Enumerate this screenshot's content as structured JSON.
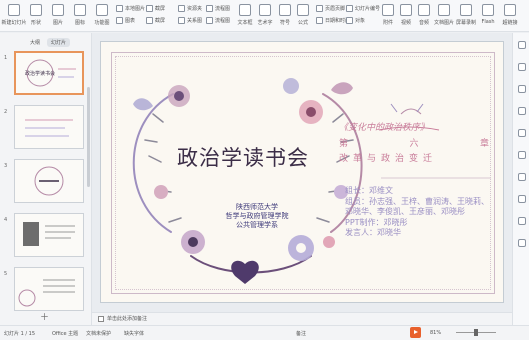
{
  "ribbon": {
    "buttons": [
      {
        "label": "新建幻灯片",
        "icon": "new-slide-icon"
      },
      {
        "label": "形状",
        "icon": "shape-icon"
      },
      {
        "label": "图片",
        "icon": "picture-icon"
      },
      {
        "label": "图标",
        "icon": "icon-icon"
      },
      {
        "label": "功能图",
        "icon": "smartart-icon"
      }
    ],
    "small": [
      [
        "本地图片",
        "图表"
      ],
      [
        "截屏",
        "截屏"
      ],
      [
        "资源夹",
        "关系图"
      ],
      [
        "流程图",
        "流程图"
      ]
    ],
    "buttons2": [
      {
        "label": "文本框",
        "icon": "textbox-icon"
      },
      {
        "label": "艺术字",
        "icon": "wordart-icon"
      },
      {
        "label": "符号",
        "icon": "symbol-icon"
      },
      {
        "label": "公式",
        "icon": "formula-icon"
      }
    ],
    "small2": [
      [
        "页眉页脚",
        "日期和时间"
      ],
      [
        "幻灯片编号",
        "对象"
      ]
    ],
    "buttons3": [
      {
        "label": "附件",
        "icon": "attach-icon"
      },
      {
        "label": "视频",
        "icon": "video-icon"
      },
      {
        "label": "音频",
        "icon": "audio-icon"
      },
      {
        "label": "文档图片",
        "icon": "doc-image-icon"
      },
      {
        "label": "屏幕录制",
        "icon": "record-icon"
      },
      {
        "label": "Flash",
        "icon": "flash-icon"
      },
      {
        "label": "超链接",
        "icon": "link-icon"
      }
    ]
  },
  "panel": {
    "tab_outline": "大纲",
    "tab_slides": "幻灯片"
  },
  "slides": [
    {
      "num": "1"
    },
    {
      "num": "2"
    },
    {
      "num": "3"
    },
    {
      "num": "4"
    },
    {
      "num": "5"
    }
  ],
  "slide": {
    "title": "政治学读书会",
    "org": [
      "陕西师范大学",
      "哲学与政府管理学院",
      "公共管理学系"
    ],
    "book": "《变化中的政治秩序》",
    "chapter": [
      "第",
      "六",
      "章"
    ],
    "subtitle": "改革与政治变迁",
    "info": [
      "组长：邓维文",
      "组员：孙志强、王梓、曹润涛、王晓莉、",
      "邓晓华、李俊凯、王彦丽、邓晓彤",
      "PPT制作：邓晓彤",
      "发言人：邓晓华"
    ]
  },
  "notes": {
    "placeholder": "单击此处添加备注"
  },
  "status": {
    "page": "幻灯片 1 / 15",
    "theme": "Office 主题",
    "doc_protect": "文档未保护",
    "missing_font": "缺失字体",
    "notes_label": "备注",
    "zoom": "81%"
  },
  "colors": {
    "accent": "#e8602c",
    "title": "#3b2d47",
    "pink": "#c97d9a",
    "lavender": "#9a8fc4"
  }
}
